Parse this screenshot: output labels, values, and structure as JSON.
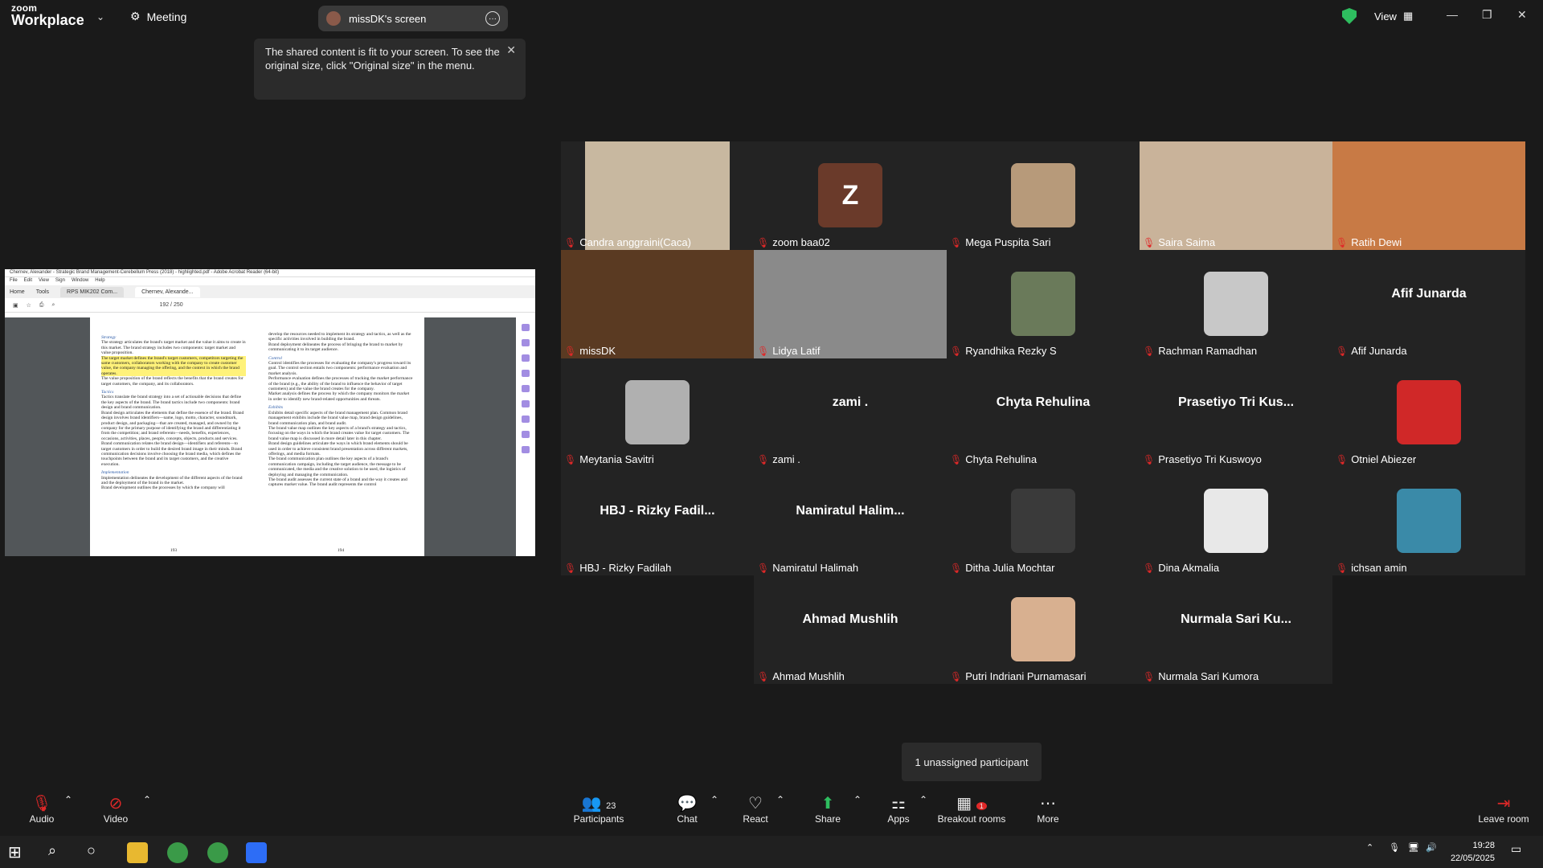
{
  "app": {
    "logo_line1": "zoom",
    "logo_line2": "Workplace",
    "meeting_label": "Meeting"
  },
  "screen_pill": {
    "label": "missDK's screen"
  },
  "view": {
    "label": "View"
  },
  "tooltip": {
    "text": "The shared content is fit to your screen. To see the original size, click \"Original size\" in the menu."
  },
  "shared_doc": {
    "window_title": "Chernev, Alexander - Strategic Brand Management-Cerebellum Press (2018) - highlighted.pdf - Adobe Acrobat Reader (64-bit)",
    "menu": [
      "File",
      "Edit",
      "View",
      "Sign",
      "Window",
      "Help"
    ],
    "tabs": [
      "Home",
      "Tools",
      "RPS MIK202 Com...",
      "Chernev, Alexande..."
    ],
    "page_indicator": "192 / 250",
    "left_page_num": "193",
    "right_page_num": "194",
    "left_heading1": "Strategy",
    "left_p1": "The strategy articulates the brand's target market and the value it aims to create in this market. The brand strategy includes two components: target market and value proposition.",
    "left_hl": "The target market defines the brand's target customers, competitors targeting the same customers, collaborators working with the company to create customer value, the company managing the offering, and the context in which the brand operates.",
    "left_p2": "The value proposition of the brand reflects the benefits that the brand creates for target customers, the company, and its collaborators.",
    "left_heading2": "Tactics",
    "left_p3": "Tactics translate the brand strategy into a set of actionable decisions that define the key aspects of the brand. The brand tactics include two components: brand design and brand communication.",
    "left_p4": "Brand design articulates the elements that define the essence of the brand. Brand design involves brand identifiers—name, logo, motto, character, soundmark, product design, and packaging—that are created, managed, and owned by the company for the primary purpose of identifying the brand and differentiating it from the competition; and brand referents—needs, benefits, experiences, occasions, activities, places, people, concepts, objects, products and services.",
    "left_p5": "Brand communication relates the brand design—identifiers and referents—to target customers in order to build the desired brand image in their minds. Brand communication decisions involve choosing the brand media, which defines the touchpoints between the brand and its target customers, and the creative execution.",
    "left_heading3": "Implementation",
    "left_p6": "Implementation delineates the development of the different aspects of the brand and the deployment of the brand in the market.",
    "left_p7": "Brand development outlines the processes by which the company will",
    "right_p1": "develop the resources needed to implement its strategy and tactics, as well as the specific activities involved in building the brand.",
    "right_p2": "Brand deployment delineates the process of bringing the brand to market by communicating it to its target audience.",
    "right_heading1": "Control",
    "right_p3": "Control identifies the processes for evaluating the company's progress toward its goal. The control section entails two components: performance evaluation and market analysis.",
    "right_p4": "Performance evaluation defines the processes of tracking the market performance of the brand (e.g., the ability of the brand to influence the behavior of target customers) and the value the brand creates for the company.",
    "right_p5": "Market analysis defines the process by which the company monitors the market in order to identify new brand-related opportunities and threats.",
    "right_heading2": "Exhibits",
    "right_p6": "Exhibits detail specific aspects of the brand management plan. Common brand management exhibits include the brand value map, brand design guidelines, brand communication plan, and brand audit.",
    "right_p7": "The brand value map outlines the key aspects of a brand's strategy and tactics, focusing on the ways in which the brand creates value for target customers. The brand value map is discussed in more detail later in this chapter.",
    "right_p8": "Brand design guidelines articulate the ways in which brand elements should be used in order to achieve consistent brand presentation across different markets, offerings, and media formats.",
    "right_p9": "The brand communication plan outlines the key aspects of a brand's communication campaign, including the target audience, the message to be communicated, the media and the creative solution to be used, the logistics of deploying and managing the communication.",
    "right_p10": "The brand audit assesses the current state of a brand and the way it creates and captures market value. The brand audit represents the control"
  },
  "participants": [
    {
      "name": "Candra anggraini(Caca)",
      "kind": "video",
      "bg": "#c8b8a0"
    },
    {
      "name": "zoom baa02",
      "kind": "letter",
      "letter": "Z",
      "bg": "#6a3a2a"
    },
    {
      "name": "Mega Puspita Sari",
      "kind": "avatar",
      "bg": "#b79a7a"
    },
    {
      "name": "Saira Saima",
      "kind": "video",
      "bg": "#c9b39a"
    },
    {
      "name": "Ratih Dewi",
      "kind": "video",
      "bg": "#c87a45"
    },
    {
      "name": "missDK",
      "kind": "video",
      "bg": "#5a3a22",
      "active": true
    },
    {
      "name": "Lidya Latif",
      "kind": "video",
      "bg": "#8a8a8a"
    },
    {
      "name": "Ryandhika Rezky S",
      "kind": "avatar",
      "bg": "#6a7a5a"
    },
    {
      "name": "Rachman Ramadhan",
      "kind": "avatar",
      "bg": "#c8c8c8"
    },
    {
      "name": "Afif Junarda",
      "kind": "text",
      "display": "Afif Junarda"
    },
    {
      "name": "Meytania Savitri",
      "kind": "avatar",
      "bg": "#b0b0b0"
    },
    {
      "name": "zami .",
      "kind": "text",
      "display": "zami ."
    },
    {
      "name": "Chyta Rehulina",
      "kind": "text",
      "display": "Chyta Rehulina"
    },
    {
      "name": "Prasetiyo Tri Kuswoyo",
      "kind": "text",
      "display": "Prasetiyo Tri Kus..."
    },
    {
      "name": "Otniel Abiezer",
      "kind": "avatar",
      "bg": "#d02828"
    },
    {
      "name": "HBJ - Rizky Fadilah",
      "kind": "text",
      "display": "HBJ - Rizky Fadil..."
    },
    {
      "name": "Namiratul Halimah",
      "kind": "text",
      "display": "Namiratul Halim..."
    },
    {
      "name": "Ditha Julia Mochtar",
      "kind": "avatar",
      "bg": "#3a3a3a"
    },
    {
      "name": "Dina Akmalia",
      "kind": "avatar",
      "bg": "#e8e8e8"
    },
    {
      "name": "ichsan amin",
      "kind": "avatar",
      "bg": "#3a8aa8"
    },
    {
      "name": "Ahmad Mushlih",
      "kind": "text",
      "display": "Ahmad Mushlih"
    },
    {
      "name": "Putri Indriani Purnamasari",
      "kind": "avatar",
      "bg": "#d8b090"
    },
    {
      "name": "Nurmala Sari Kumora",
      "kind": "text",
      "display": "Nurmala Sari Ku..."
    }
  ],
  "unassigned": {
    "text": "1 unassigned participant"
  },
  "toolbar": {
    "audio": "Audio",
    "video": "Video",
    "participants": "Participants",
    "participants_count": "23",
    "chat": "Chat",
    "react": "React",
    "share": "Share",
    "apps": "Apps",
    "breakout": "Breakout rooms",
    "breakout_badge": "1",
    "more": "More",
    "leave": "Leave room"
  },
  "taskbar": {
    "time": "19:28",
    "date": "22/05/2025"
  },
  "colors": {
    "accent_green": "#23d160",
    "mic_red": "#e02828",
    "share_green": "#2ebd5f"
  }
}
